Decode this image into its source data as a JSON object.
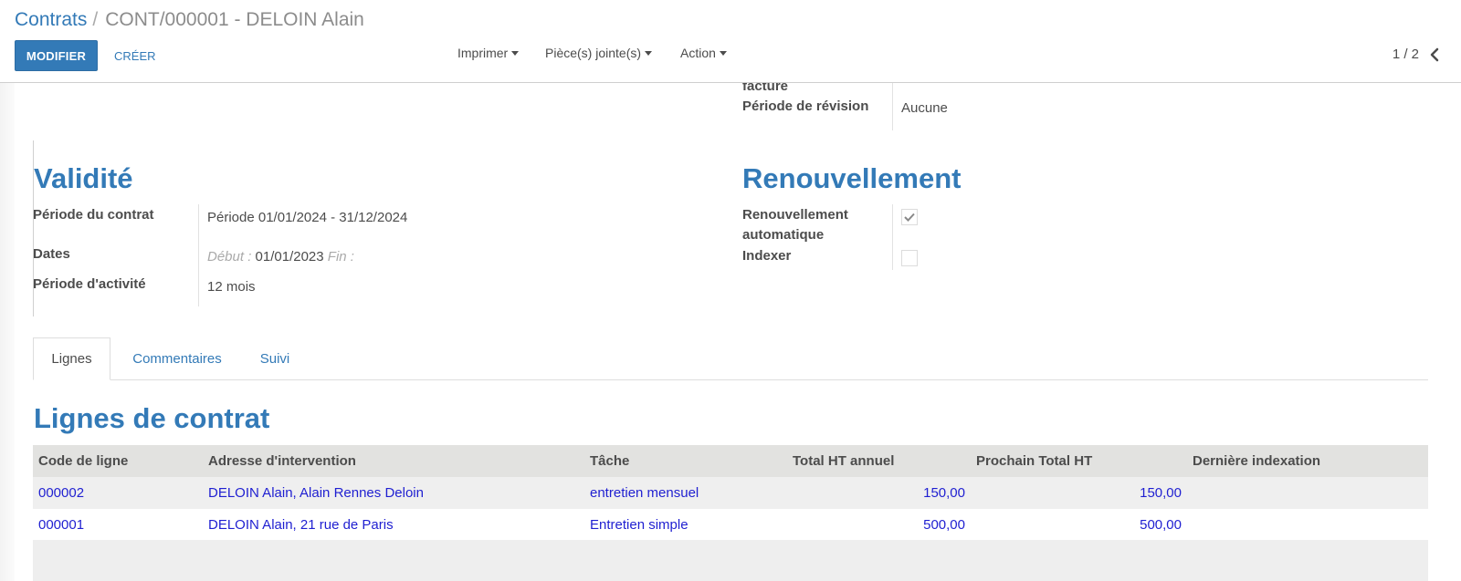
{
  "breadcrumb": {
    "parent": "Contrats",
    "separator": "/",
    "current": "CONT/000001 - DELOIN Alain"
  },
  "buttons": {
    "edit": "MODIFIER",
    "create": "CRÉER"
  },
  "menus": {
    "print": "Imprimer",
    "attachments": "Pièce(s) jointe(s)",
    "action": "Action"
  },
  "pager": {
    "value": "1 / 2"
  },
  "top_fields": {
    "invoice_label_tail": "facture",
    "revision_label": "Période de révision",
    "revision_value": "Aucune"
  },
  "validity": {
    "title": "Validité",
    "period_label": "Période du contrat",
    "period_value": "Période 01/01/2024 - 31/12/2024",
    "dates_label": "Dates",
    "dates_start_label": "Début :",
    "dates_start_value": "01/01/2023",
    "dates_end_label": "Fin :",
    "activity_label": "Période d'activité",
    "activity_value": "12 mois"
  },
  "renewal": {
    "title": "Renouvellement",
    "auto_label_line1": "Renouvellement",
    "auto_label_line2": "automatique",
    "auto_checked": true,
    "index_label": "Indexer",
    "index_checked": false
  },
  "tabs": [
    "Lignes",
    "Commentaires",
    "Suivi"
  ],
  "lines": {
    "title": "Lignes de contrat",
    "headers": [
      "Code de ligne",
      "Adresse d'intervention",
      "Tâche",
      "Total HT annuel",
      "Prochain Total HT",
      "Dernière indexation"
    ],
    "rows": [
      [
        "000002",
        "DELOIN Alain, Alain Rennes Deloin",
        "entretien mensuel",
        "150,00",
        "150,00",
        ""
      ],
      [
        "000001",
        "DELOIN Alain, 21 rue de Paris",
        "Entretien simple",
        "500,00",
        "500,00",
        ""
      ]
    ]
  },
  "colors": {
    "accent": "#337ab7",
    "link": "#1f1fd1",
    "table_header_bg": "#e2e2e0"
  }
}
